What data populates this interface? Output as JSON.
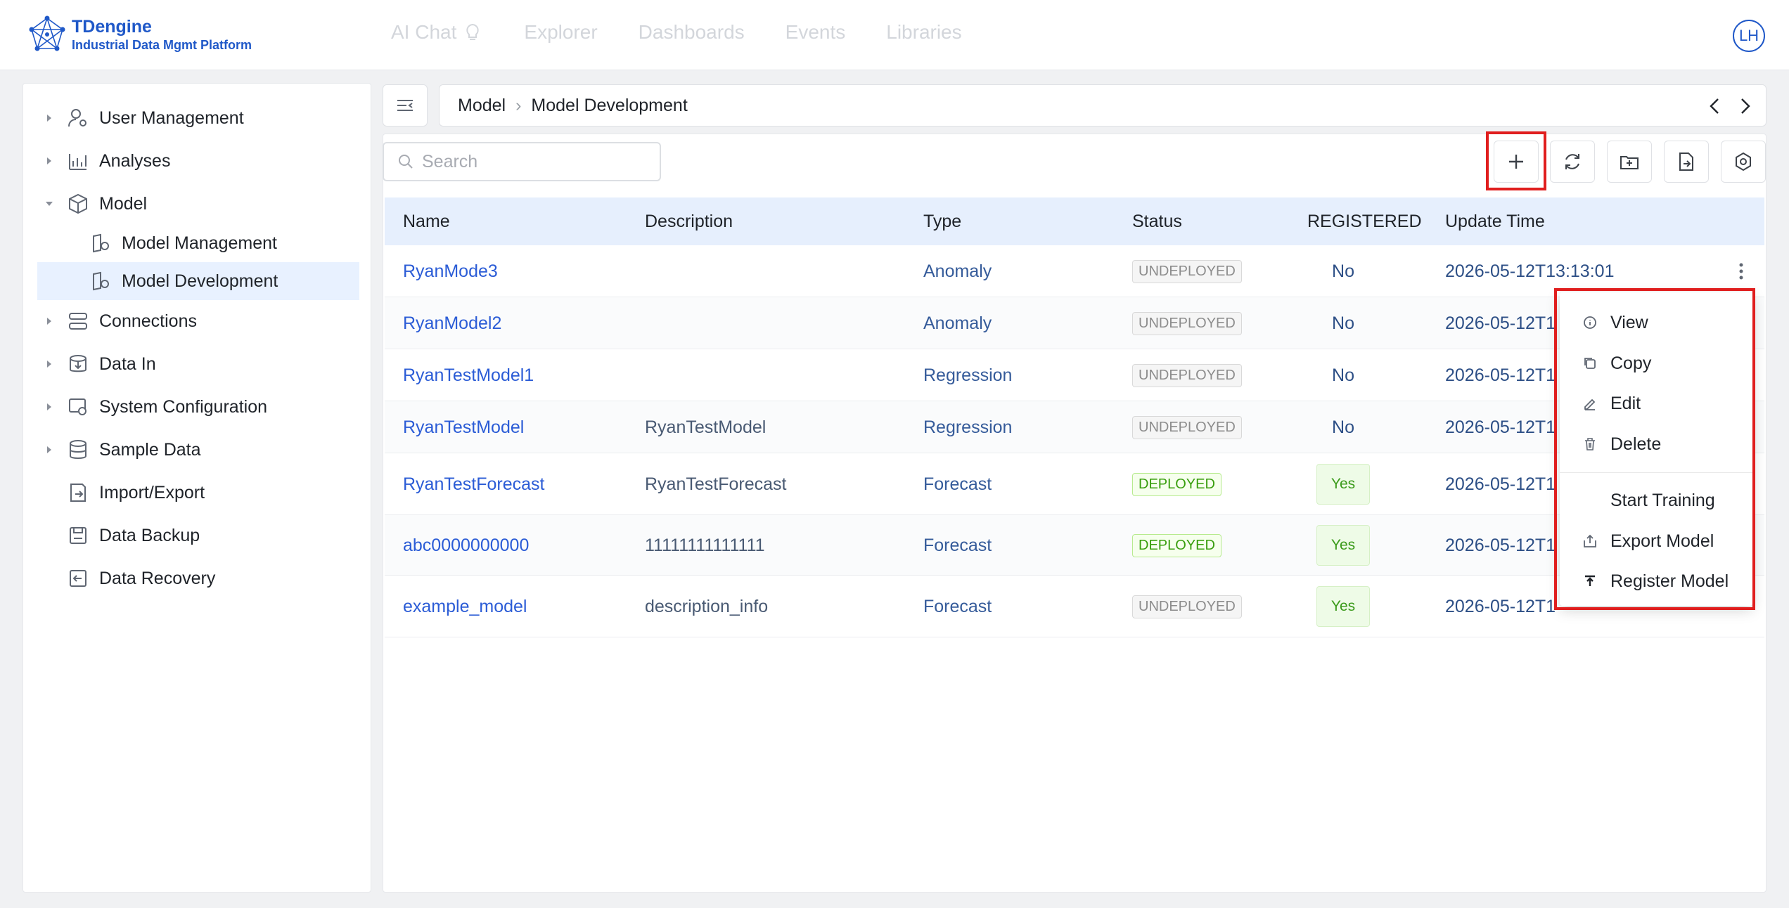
{
  "app": {
    "name": "TDengine",
    "subtitle": "Industrial Data Mgmt Platform",
    "user_initials": "LH"
  },
  "topnav": [
    {
      "label": "AI Chat"
    },
    {
      "label": "Explorer"
    },
    {
      "label": "Dashboards"
    },
    {
      "label": "Events"
    },
    {
      "label": "Libraries"
    }
  ],
  "sidebar": {
    "items": [
      {
        "label": "User Management",
        "icon": "user-gear-icon",
        "expandable": true
      },
      {
        "label": "Analyses",
        "icon": "chart-icon",
        "expandable": true
      },
      {
        "label": "Model",
        "icon": "cube-icon",
        "expandable": true,
        "expanded": true
      },
      {
        "label": "Model Management",
        "icon": "model-icon"
      },
      {
        "label": "Model Development",
        "icon": "model-icon",
        "active": true
      },
      {
        "label": "Connections",
        "icon": "connections-icon",
        "expandable": true
      },
      {
        "label": "Data In",
        "icon": "data-in-icon",
        "expandable": true
      },
      {
        "label": "System Configuration",
        "icon": "system-config-icon",
        "expandable": true
      },
      {
        "label": "Sample Data",
        "icon": "database-icon",
        "expandable": true
      },
      {
        "label": "Import/Export",
        "icon": "import-export-icon"
      },
      {
        "label": "Data Backup",
        "icon": "backup-icon"
      },
      {
        "label": "Data Recovery",
        "icon": "recovery-icon"
      }
    ]
  },
  "breadcrumb": {
    "root": "Model",
    "current": "Model Development"
  },
  "search": {
    "placeholder": "Search",
    "value": ""
  },
  "toolbar": {
    "buttons": [
      "add-icon",
      "refresh-icon",
      "import-folder-icon",
      "export-file-icon",
      "settings-icon"
    ]
  },
  "table": {
    "headers": {
      "name": "Name",
      "description": "Description",
      "type": "Type",
      "status": "Status",
      "registered": "REGISTERED",
      "update_time": "Update Time"
    },
    "rows": [
      {
        "name": "RyanMode3",
        "description": "",
        "type": "Anomaly",
        "status": "UNDEPLOYED",
        "registered": "No",
        "update_time": "2026-05-12T13:13:01"
      },
      {
        "name": "RyanModel2",
        "description": "",
        "type": "Anomaly",
        "status": "UNDEPLOYED",
        "registered": "No",
        "update_time": "2026-05-12T1"
      },
      {
        "name": "RyanTestModel1",
        "description": "",
        "type": "Regression",
        "status": "UNDEPLOYED",
        "registered": "No",
        "update_time": "2026-05-12T1"
      },
      {
        "name": "RyanTestModel",
        "description": "RyanTestModel",
        "type": "Regression",
        "status": "UNDEPLOYED",
        "registered": "No",
        "update_time": "2026-05-12T1"
      },
      {
        "name": "RyanTestForecast",
        "description": "RyanTestForecast",
        "type": "Forecast",
        "status": "DEPLOYED",
        "registered": "Yes",
        "update_time": "2026-05-12T1"
      },
      {
        "name": "abc0000000000",
        "description": "11111111111111",
        "type": "Forecast",
        "status": "DEPLOYED",
        "registered": "Yes",
        "update_time": "2026-05-12T1"
      },
      {
        "name": "example_model",
        "description": "description_info",
        "type": "Forecast",
        "status": "UNDEPLOYED",
        "registered": "Yes",
        "update_time": "2026-05-12T1"
      }
    ]
  },
  "context_menu": {
    "items": [
      {
        "label": "View",
        "icon": "info-icon"
      },
      {
        "label": "Copy",
        "icon": "copy-icon"
      },
      {
        "label": "Edit",
        "icon": "edit-icon"
      },
      {
        "label": "Delete",
        "icon": "trash-icon"
      },
      {
        "label": "Start Training",
        "icon": ""
      },
      {
        "label": "Export Model",
        "icon": "export-icon"
      },
      {
        "label": "Register Model",
        "icon": "register-icon"
      }
    ]
  },
  "colors": {
    "brand": "#1f58c8",
    "link": "#2b5cd6",
    "highlight_red": "#e01e1e",
    "header_bg": "#e6effd",
    "deployed_green": "#389e0d"
  }
}
